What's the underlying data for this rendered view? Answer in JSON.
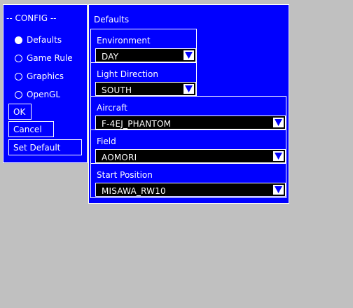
{
  "config": {
    "title": "-- CONFIG --",
    "tabs": [
      {
        "label": "Defaults",
        "selected": true
      },
      {
        "label": "Game Rule",
        "selected": false
      },
      {
        "label": "Graphics",
        "selected": false
      },
      {
        "label": "OpenGL",
        "selected": false
      }
    ],
    "ok_label": "OK",
    "cancel_label": "Cancel",
    "set_default_label": "Set Default"
  },
  "defaults": {
    "heading": "Defaults",
    "environment": {
      "label": "Environment",
      "value": "DAY"
    },
    "light_direction": {
      "label": "Light Direction",
      "value": "SOUTH"
    },
    "aircraft": {
      "label": "Aircraft",
      "value": "F-4EJ_PHANTOM"
    },
    "field": {
      "label": "Field",
      "value": "AOMORI"
    },
    "start_position": {
      "label": "Start Position",
      "value": "MISAWA_RW10"
    }
  },
  "icons": {
    "dropdown": "triangle-down-icon"
  },
  "colors": {
    "panel": "#0000ff",
    "background": "#c0c0c0",
    "field": "#000000",
    "text": "#ffffff"
  }
}
